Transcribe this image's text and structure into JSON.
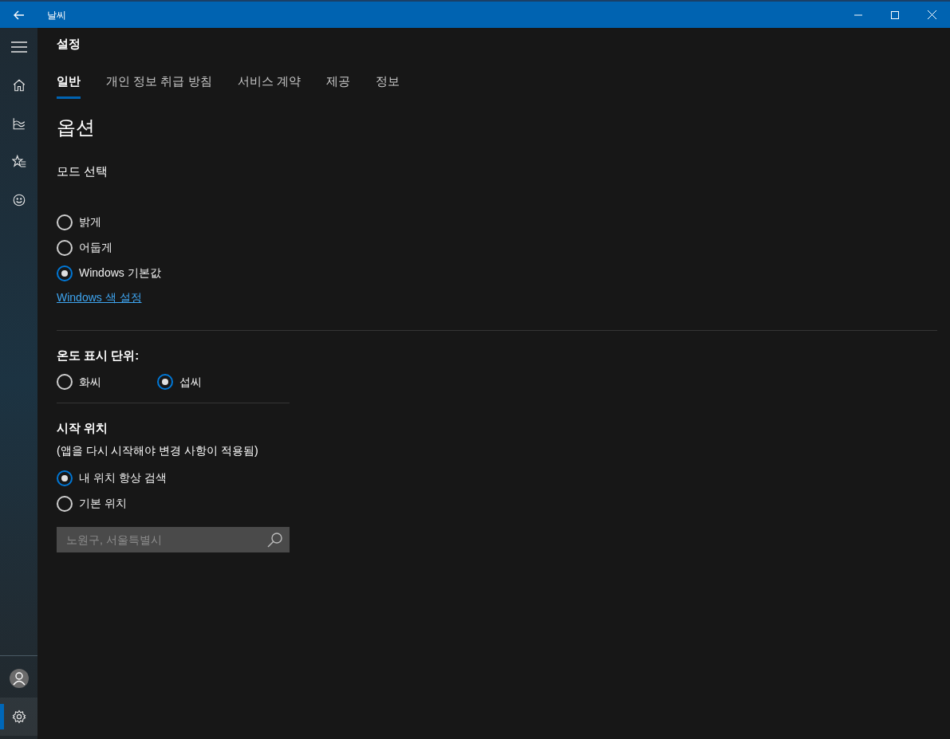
{
  "window": {
    "title": "날씨"
  },
  "sidebar": {
    "items": [
      {
        "kind": "home",
        "selected": false
      },
      {
        "kind": "chart",
        "selected": false
      },
      {
        "kind": "favorites",
        "selected": false
      },
      {
        "kind": "smiley",
        "selected": false
      }
    ],
    "bottom_items": [
      {
        "kind": "account",
        "selected": false
      },
      {
        "kind": "settings",
        "selected": true
      }
    ]
  },
  "page_title": "설정",
  "tabs": [
    {
      "label": "일반",
      "selected": true
    },
    {
      "label": "개인 정보 취급 방침",
      "selected": false
    },
    {
      "label": "서비스 계약",
      "selected": false
    },
    {
      "label": "제공",
      "selected": false
    },
    {
      "label": "정보",
      "selected": false
    }
  ],
  "section_title": "옵션",
  "mode": {
    "label": "모드 선택",
    "options": [
      {
        "label": "밝게",
        "selected": false
      },
      {
        "label": "어둡게",
        "selected": false
      },
      {
        "label": "Windows 기본값",
        "selected": true
      }
    ],
    "link": "Windows 색 설정"
  },
  "units": {
    "label": "온도 표시 단위:",
    "options": [
      {
        "label": "화씨",
        "selected": false
      },
      {
        "label": "섭씨",
        "selected": true
      }
    ]
  },
  "launch": {
    "label": "시작 위치",
    "note": "(앱을 다시 시작해야 변경 사항이 적용됨)",
    "options": [
      {
        "label": "내 위치 항상 검색",
        "selected": true
      },
      {
        "label": "기본 위치",
        "selected": false
      }
    ],
    "search": {
      "placeholder": "노원구, 서울특별시"
    }
  }
}
